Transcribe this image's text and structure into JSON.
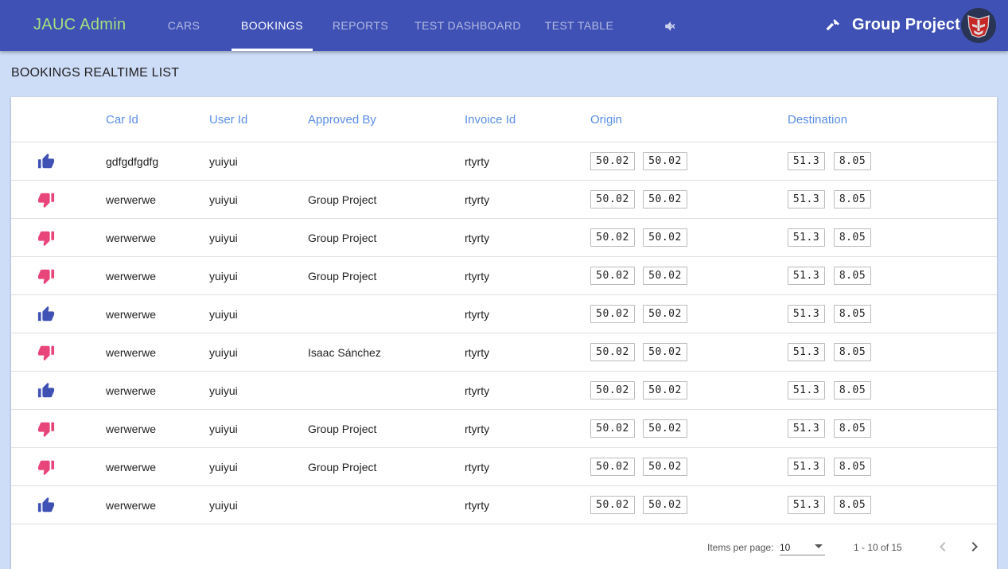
{
  "app": {
    "brand": "JAUC Admin",
    "user_name": "Group Project"
  },
  "nav": {
    "tabs": [
      {
        "label": "CARS",
        "active": false
      },
      {
        "label": "BOOKINGS",
        "active": true
      },
      {
        "label": "REPORTS",
        "active": false
      },
      {
        "label": "TEST DASHBOARD",
        "active": false
      },
      {
        "label": "TEST TABLE",
        "active": false
      }
    ]
  },
  "icons": {
    "mute": "volume-off-icon",
    "build": "hammer-icon",
    "avatar": "autobot-avatar",
    "approved": "thumb-up-icon",
    "rejected": "thumb-down-icon"
  },
  "colors": {
    "toolbar": "#3f51b5",
    "brand": "#a5e07f",
    "header_text": "#5b8ee6",
    "approved": "#3f51b5",
    "rejected": "#e8457a",
    "page_bg": "#cddcf7"
  },
  "page": {
    "title": "BOOKINGS REALTIME LIST"
  },
  "table": {
    "columns": [
      "",
      "Car Id",
      "User Id",
      "Approved By",
      "Invoice Id",
      "Origin",
      "Destination"
    ],
    "rows": [
      {
        "status": "approved",
        "car_id": "gdfgdfgdfg",
        "user_id": "yuiyui",
        "approved_by": "",
        "invoice_id": "rtyrty",
        "origin": [
          "50.02",
          "50.02"
        ],
        "destination": [
          "51.3",
          "8.05"
        ]
      },
      {
        "status": "rejected",
        "car_id": "werwerwe",
        "user_id": "yuiyui",
        "approved_by": "Group Project",
        "invoice_id": "rtyrty",
        "origin": [
          "50.02",
          "50.02"
        ],
        "destination": [
          "51.3",
          "8.05"
        ]
      },
      {
        "status": "rejected",
        "car_id": "werwerwe",
        "user_id": "yuiyui",
        "approved_by": "Group Project",
        "invoice_id": "rtyrty",
        "origin": [
          "50.02",
          "50.02"
        ],
        "destination": [
          "51.3",
          "8.05"
        ]
      },
      {
        "status": "rejected",
        "car_id": "werwerwe",
        "user_id": "yuiyui",
        "approved_by": "Group Project",
        "invoice_id": "rtyrty",
        "origin": [
          "50.02",
          "50.02"
        ],
        "destination": [
          "51.3",
          "8.05"
        ]
      },
      {
        "status": "approved",
        "car_id": "werwerwe",
        "user_id": "yuiyui",
        "approved_by": "",
        "invoice_id": "rtyrty",
        "origin": [
          "50.02",
          "50.02"
        ],
        "destination": [
          "51.3",
          "8.05"
        ]
      },
      {
        "status": "rejected",
        "car_id": "werwerwe",
        "user_id": "yuiyui",
        "approved_by": "Isaac Sánchez",
        "invoice_id": "rtyrty",
        "origin": [
          "50.02",
          "50.02"
        ],
        "destination": [
          "51.3",
          "8.05"
        ]
      },
      {
        "status": "approved",
        "car_id": "werwerwe",
        "user_id": "yuiyui",
        "approved_by": "",
        "invoice_id": "rtyrty",
        "origin": [
          "50.02",
          "50.02"
        ],
        "destination": [
          "51.3",
          "8.05"
        ]
      },
      {
        "status": "rejected",
        "car_id": "werwerwe",
        "user_id": "yuiyui",
        "approved_by": "Group Project",
        "invoice_id": "rtyrty",
        "origin": [
          "50.02",
          "50.02"
        ],
        "destination": [
          "51.3",
          "8.05"
        ]
      },
      {
        "status": "rejected",
        "car_id": "werwerwe",
        "user_id": "yuiyui",
        "approved_by": "Group Project",
        "invoice_id": "rtyrty",
        "origin": [
          "50.02",
          "50.02"
        ],
        "destination": [
          "51.3",
          "8.05"
        ]
      },
      {
        "status": "approved",
        "car_id": "werwerwe",
        "user_id": "yuiyui",
        "approved_by": "",
        "invoice_id": "rtyrty",
        "origin": [
          "50.02",
          "50.02"
        ],
        "destination": [
          "51.3",
          "8.05"
        ]
      }
    ]
  },
  "paginator": {
    "label": "Items per page:",
    "page_size": "10",
    "range": "1 - 10 of 15"
  }
}
